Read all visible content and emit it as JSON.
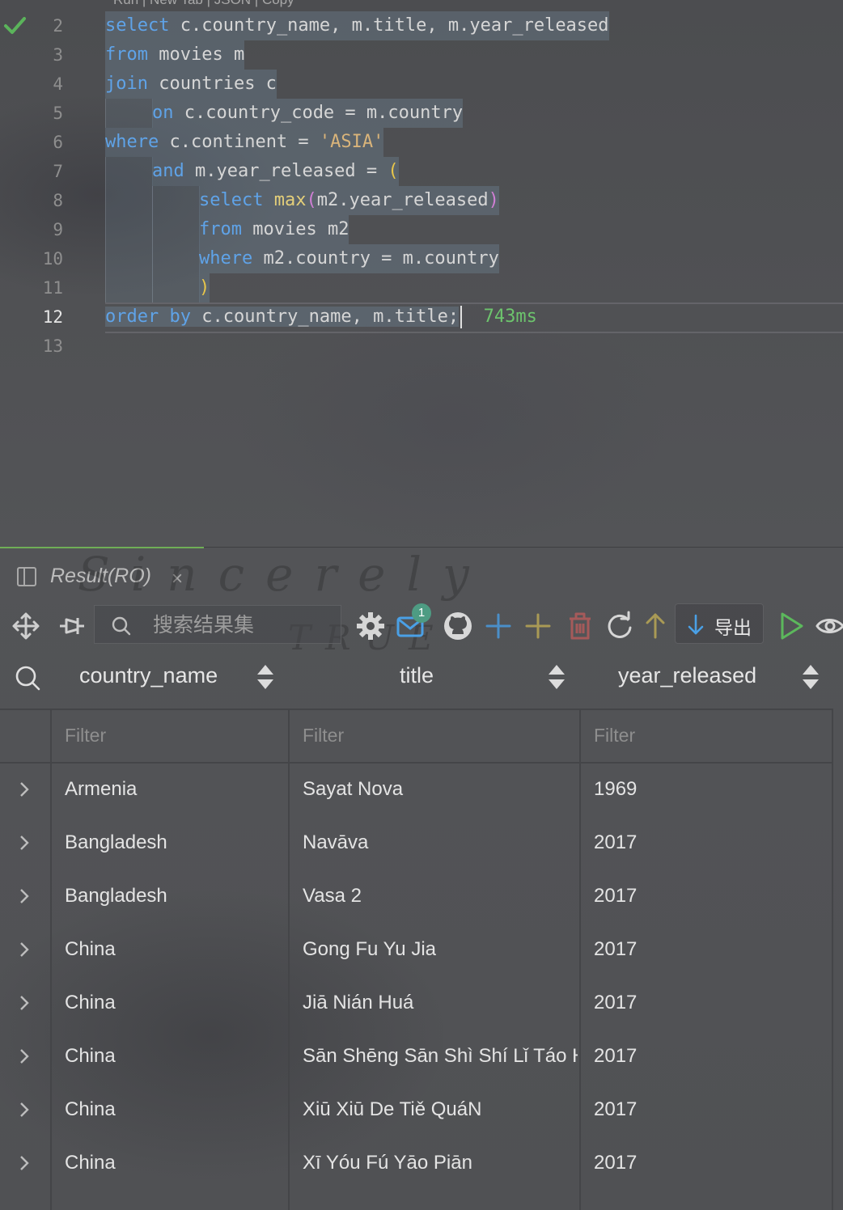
{
  "editor": {
    "codelens": "Run | New Tab | JSON | Copy",
    "timing": "743ms",
    "lines": [
      {
        "n": "2",
        "parts": [
          [
            "kw",
            "select"
          ],
          [
            "",
            "c.country_name, m.title, m.year_released"
          ]
        ]
      },
      {
        "n": "3",
        "parts": [
          [
            "kw",
            "from"
          ],
          [
            "",
            "movies m"
          ]
        ]
      },
      {
        "n": "4",
        "parts": [
          [
            "kw",
            "join"
          ],
          [
            "",
            "countries c"
          ]
        ]
      },
      {
        "n": "5",
        "parts": [
          [
            "kw",
            "on"
          ],
          [
            "",
            "c.country_code = m.country"
          ]
        ]
      },
      {
        "n": "6",
        "parts": [
          [
            "kw",
            "where"
          ],
          [
            "",
            "c.continent = "
          ],
          [
            "str",
            "'ASIA'"
          ]
        ]
      },
      {
        "n": "7",
        "parts": [
          [
            "kw",
            "and"
          ],
          [
            "",
            "m.year_released = "
          ],
          [
            "paren-y",
            "("
          ]
        ]
      },
      {
        "n": "8",
        "parts": [
          [
            "kw",
            "select"
          ],
          [
            "fn",
            "max"
          ],
          [
            "paren-p",
            "("
          ],
          [
            "",
            "m2.year_released"
          ],
          [
            "paren-p",
            ")"
          ]
        ]
      },
      {
        "n": "9",
        "parts": [
          [
            "kw",
            "from"
          ],
          [
            "",
            "movies m2"
          ]
        ]
      },
      {
        "n": "10",
        "parts": [
          [
            "kw",
            "where"
          ],
          [
            "",
            "m2.country = m.country"
          ]
        ]
      },
      {
        "n": "11",
        "parts": [
          [
            "paren-y",
            ")"
          ]
        ]
      },
      {
        "n": "12",
        "parts": [
          [
            "kw",
            "order by"
          ],
          [
            "",
            "c.country_name, m.title;"
          ]
        ]
      },
      {
        "n": "13",
        "parts": []
      }
    ]
  },
  "result_tab": {
    "label": "Result(RO)",
    "close": "×"
  },
  "watermark": {
    "line1": "Sincerely",
    "line2": "TRUE"
  },
  "toolbar": {
    "search_placeholder": "搜索结果集",
    "mail_badge": "1",
    "export_label": "导出",
    "icons": [
      "move-icon",
      "pin-icon",
      "settings-icon",
      "mail-icon",
      "github-icon",
      "add-row-icon",
      "add-icon",
      "delete-icon",
      "refresh-icon",
      "upload-icon",
      "export-icon",
      "run-icon",
      "eye-icon"
    ]
  },
  "columns": [
    {
      "label": "country_name"
    },
    {
      "label": "title"
    },
    {
      "label": "year_released"
    }
  ],
  "filter_placeholder": "Filter",
  "rows": [
    {
      "country_name": "Armenia",
      "title": "Sayat Nova",
      "year_released": "1969"
    },
    {
      "country_name": "Bangladesh",
      "title": "Navāva",
      "year_released": "2017"
    },
    {
      "country_name": "Bangladesh",
      "title": "Vasa 2",
      "year_released": "2017"
    },
    {
      "country_name": "China",
      "title": "Gong Fu Yu Jia",
      "year_released": "2017"
    },
    {
      "country_name": "China",
      "title": "Jiā Nián Huá",
      "year_released": "2017"
    },
    {
      "country_name": "China",
      "title": "Sān Shēng Sān Shì Shí Lǐ Táo H",
      "year_released": "2017"
    },
    {
      "country_name": "China",
      "title": "Xiū Xiū De Tiě QuáN",
      "year_released": "2017"
    },
    {
      "country_name": "China",
      "title": "Xī Yóu Fú Yāo Piān",
      "year_released": "2017"
    }
  ],
  "colors": {
    "keyword": "#5fa3e8",
    "function": "#e4cf7a",
    "string": "#d9b47a",
    "success": "#6dc46d",
    "tab_accent": "#6fae56"
  }
}
